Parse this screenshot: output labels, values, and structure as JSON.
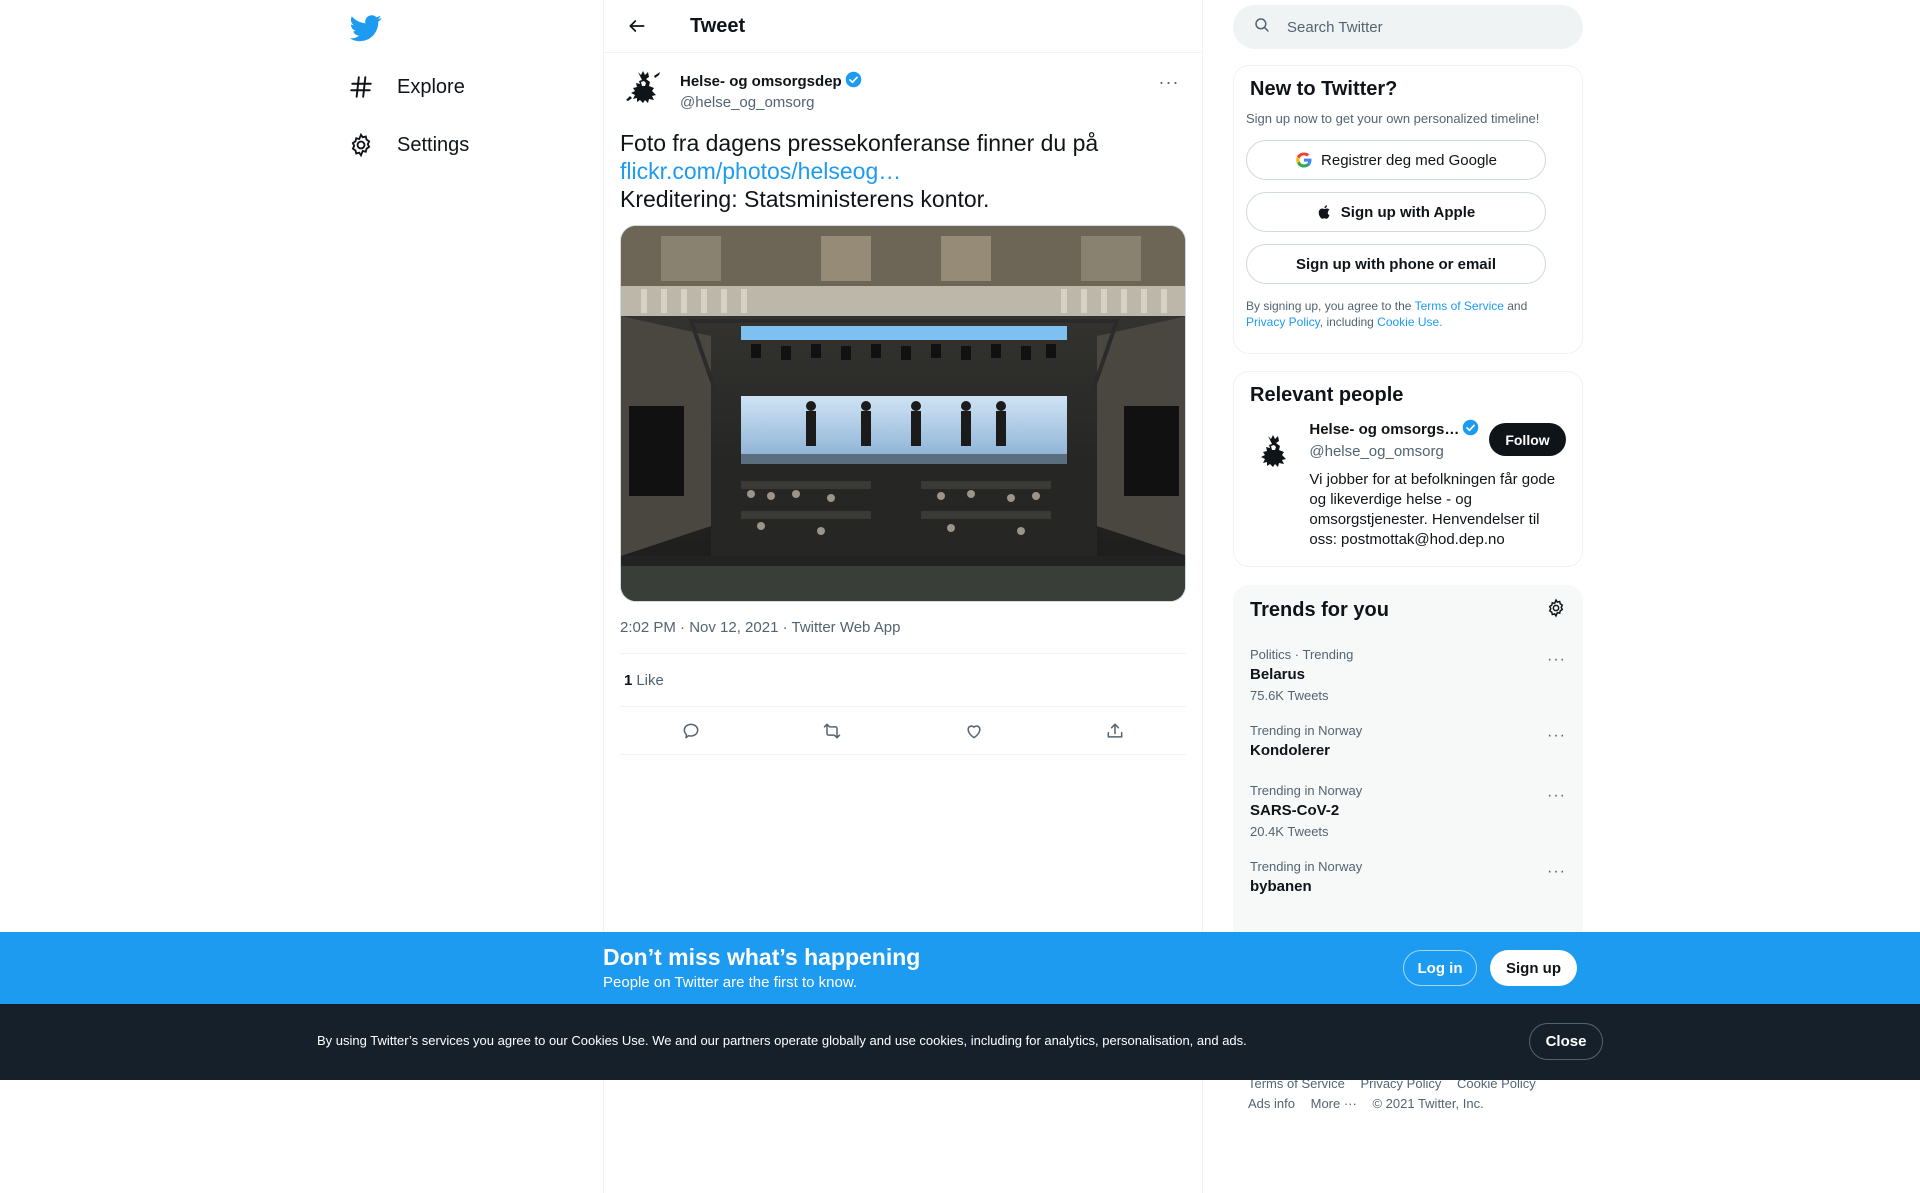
{
  "nav": {
    "items": [
      {
        "label": "Explore",
        "icon": "hashtag-icon"
      },
      {
        "label": "Settings",
        "icon": "gear-icon"
      }
    ]
  },
  "header": {
    "title": "Tweet"
  },
  "tweet": {
    "author_name": "Helse- og omsorgsdep",
    "author_handle": "@helse_og_omsorg",
    "text_line1": "Foto fra dagens pressekonferanse finner du på",
    "link": "flickr.com/photos/helseog…",
    "text_line3": "Kreditering: Statsministerens kontor.",
    "meta": "2:02 PM · Nov 12, 2021 · Twitter Web App",
    "like_count": "1",
    "like_label": "Like"
  },
  "search": {
    "placeholder": "Search Twitter"
  },
  "signup": {
    "title": "New to Twitter?",
    "subtitle": "Sign up now to get your own personalized timeline!",
    "google_label": "Registrer deg med Google",
    "apple_label": "Sign up with Apple",
    "phone_label": "Sign up with phone or email",
    "legal_1": "By signing up, you agree to the ",
    "legal_tos": "Terms of Service",
    "legal_2": " and ",
    "legal_privacy": "Privacy Policy",
    "legal_3": ", including ",
    "legal_cookie": "Cookie Use."
  },
  "people": {
    "title": "Relevant people",
    "name": "Helse- og omsorgs…",
    "handle": "@helse_og_omsorg",
    "bio": "Vi jobber for at befolkningen får gode og likeverdige helse - og omsorgstjenester. Henvendelser til oss: postmottak@hod.dep.no",
    "follow_label": "Follow"
  },
  "trends": {
    "title": "Trends for you",
    "items": [
      {
        "context": "Politics · Trending",
        "name": "Belarus",
        "count": "75.6K Tweets"
      },
      {
        "context": "Trending in Norway",
        "name": "Kondolerer",
        "count": ""
      },
      {
        "context": "Trending in Norway",
        "name": "SARS-CoV-2",
        "count": "20.4K Tweets"
      },
      {
        "context": "Trending in Norway",
        "name": "bybanen",
        "count": ""
      }
    ]
  },
  "footer": {
    "tos": "Terms of Service",
    "privacy": "Privacy Policy",
    "cookie": "Cookie Policy",
    "ads": "Ads info",
    "more": "More ···",
    "copyright": "© 2021 Twitter, Inc."
  },
  "banner": {
    "title": "Don’t miss what’s happening",
    "subtitle": "People on Twitter are the first to know.",
    "login_label": "Log in",
    "signup_label": "Sign up"
  },
  "cookie": {
    "text": "By using Twitter’s services you agree to our Cookies Use. We and our partners operate globally and use cookies, including for analytics, personalisation, and ads.",
    "close_label": "Close"
  },
  "colors": {
    "brand": "#1d9bf0",
    "text": "#0f1419",
    "secondary": "#536471",
    "cookie_bg": "#15202b"
  }
}
